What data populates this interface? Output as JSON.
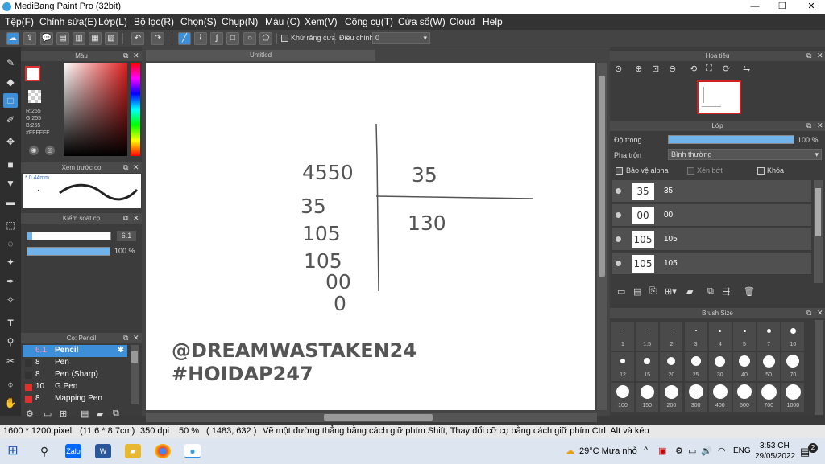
{
  "window": {
    "title": "MediBang Paint Pro (32bit)",
    "minimize": "—",
    "maximize": "❐",
    "close": "✕"
  },
  "menu": [
    "Tệp(F)",
    "Chỉnh sửa(E)",
    "Lớp(L)",
    "Bộ lọc(R)",
    "Chọn(S)",
    "Chụp(N)",
    "Màu (C)",
    "Xem(V)",
    "Công cụ(T)",
    "Cửa sổ(W)",
    "Cloud",
    "Help"
  ],
  "toolbar": {
    "antialias_label": "Khử răng cưa",
    "adjust_label": "Điều chỉnh",
    "adjust_value": "0"
  },
  "color_panel": {
    "title": "Màu",
    "r": "R:255",
    "g": "G:255",
    "b": "B:255",
    "hex": "#FFFFFF",
    "primary_color": "#ffffff"
  },
  "brush_preview": {
    "title": "Xem trước cọ",
    "size": "* 0.44mm"
  },
  "brush_control": {
    "title": "Kiểm soát cọ",
    "size_value": "6.1",
    "opacity_value": "100 %",
    "size_fraction": 0.06,
    "opacity_fraction": 1.0
  },
  "brush_list": {
    "title": "Cọ: Pencil",
    "items": [
      {
        "size": "6.1",
        "name": "Pencil",
        "color": "#3d8fd8",
        "selected": true
      },
      {
        "size": "8",
        "name": "Pen",
        "color": "#333333"
      },
      {
        "size": "8",
        "name": "Pen (Sharp)",
        "color": "#333333"
      },
      {
        "size": "10",
        "name": "G Pen",
        "color": "#e03030"
      },
      {
        "size": "8",
        "name": "Mapping Pen",
        "color": "#e03030"
      }
    ]
  },
  "canvas": {
    "tab": "Untitled",
    "numbers": [
      "4550",
      "35",
      "105",
      "105",
      "00",
      "0",
      "35",
      "130"
    ],
    "watermark_line1": "@DREAMWASTAKEN24",
    "watermark_line2": "#HOIDAP247"
  },
  "navigator": {
    "title": "Hoa tiêu"
  },
  "layer_panel": {
    "title": "Lớp",
    "opacity_label": "Độ trong",
    "opacity_value": "100 %",
    "opacity_fraction": 1.0,
    "blend_label": "Pha trộn",
    "blend_value": "Bình thường",
    "protect_alpha": "Bảo vệ alpha",
    "clipping": "Xén bớt",
    "lock": "Khóa",
    "layers": [
      {
        "thumb": "35",
        "name": "35"
      },
      {
        "thumb": "00",
        "name": "00"
      },
      {
        "thumb": "105",
        "name": "105"
      },
      {
        "thumb": "105",
        "name": "105"
      }
    ]
  },
  "brush_size": {
    "title": "Brush Size",
    "sizes": [
      "1",
      "1.5",
      "2",
      "3",
      "4",
      "5",
      "7",
      "10",
      "12",
      "15",
      "20",
      "25",
      "30",
      "40",
      "50",
      "70",
      "100",
      "150",
      "200",
      "300",
      "400",
      "500",
      "700",
      "1000"
    ]
  },
  "status": {
    "dimensions": "1600 * 1200 pixel",
    "physical": "(11.6 * 8.7cm)",
    "dpi": "350 dpi",
    "zoom": "50 %",
    "cursor": "( 1483, 632 )",
    "hint": "Vẽ một đường thẳng bằng cách giữ phím Shift, Thay đổi cỡ cọ bằng cách giữ phím Ctrl, Alt và kéo"
  },
  "taskbar": {
    "weather": "29°C  Mưa nhỏ",
    "lang": "ENG",
    "time": "3:53 CH",
    "date": "29/05/2022",
    "notif_count": "2",
    "apps": [
      "Zalo",
      "W",
      "Chrome",
      "MediBang"
    ]
  }
}
